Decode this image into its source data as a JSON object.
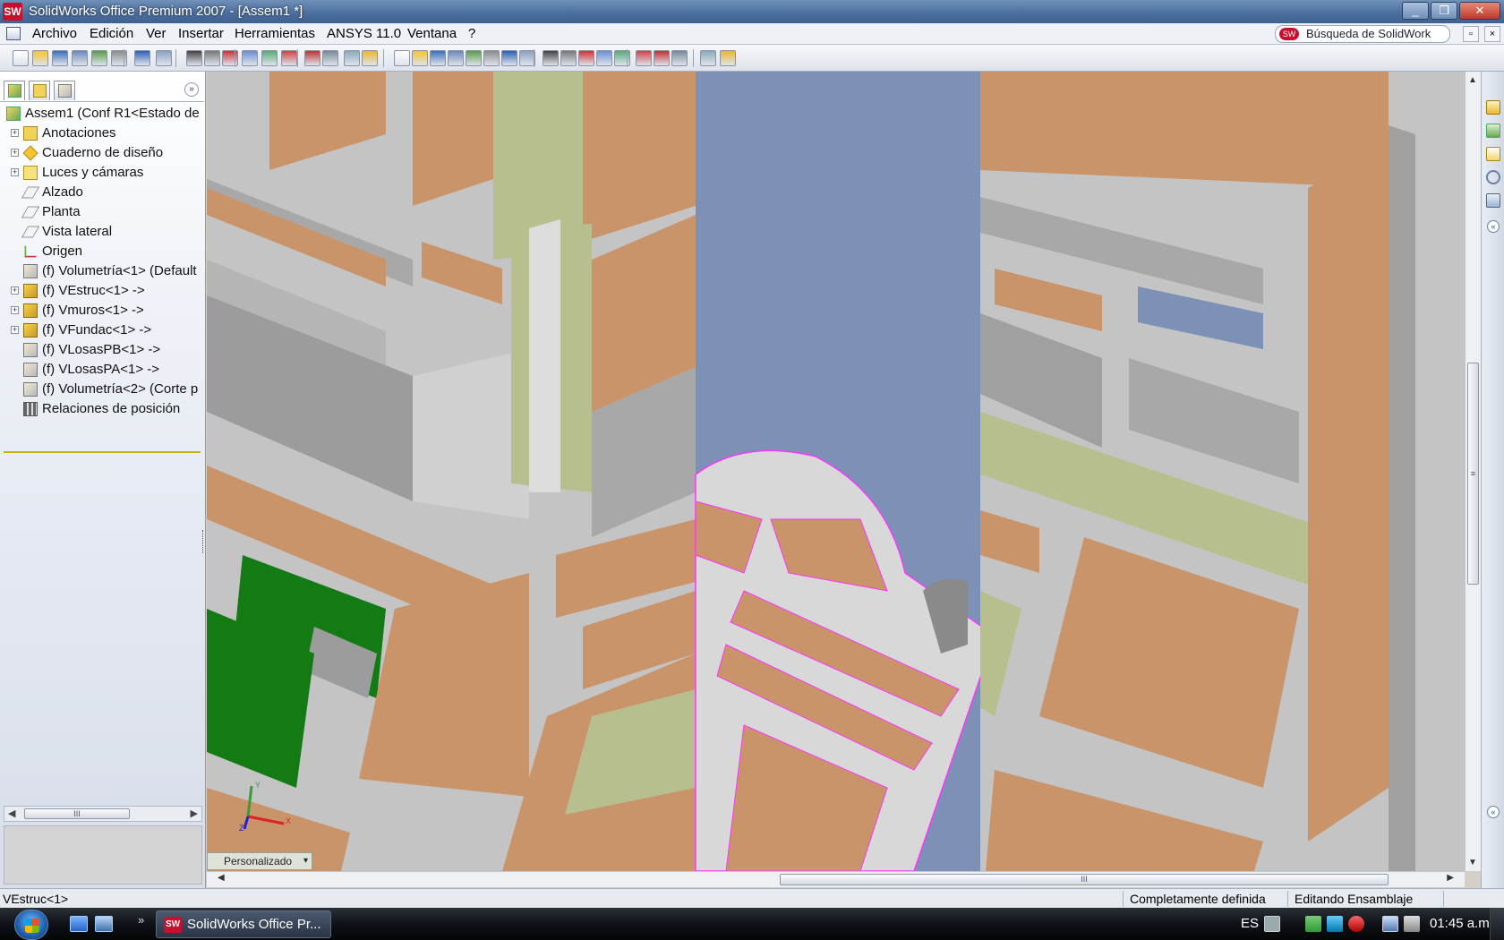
{
  "window": {
    "app_icon": "sw-logo-icon",
    "app_icon_text": "SW",
    "title": "SolidWorks Office Premium 2007 - [Assem1 *]",
    "controls": {
      "minimize": "_",
      "restore": "❐",
      "close": "✕"
    }
  },
  "menu": {
    "items": [
      "Archivo",
      "Edición",
      "Ver",
      "Insertar",
      "Herramientas",
      "ANSYS 11.0",
      "Ventana",
      "?"
    ],
    "search_placeholder": "Búsqueda de SolidWork",
    "search_logo_text": "SW",
    "doc_restore": "▫",
    "doc_close": "×"
  },
  "toolbar": {
    "icons": [
      "new-icon",
      "open-icon",
      "save-icon",
      "print-preview-icon",
      "options-icon",
      "print-icon",
      "undo-icon",
      "redo-icon",
      "select-icon",
      "smart-dimension-icon",
      "rebuild-icon",
      "grid-icon",
      "insert-component-icon",
      "mate-icon",
      "display-style-icon",
      "section-view-icon",
      "properties-icon",
      "help-icon",
      "zoom-fit-icon",
      "zoom-area-icon",
      "zoom-in-out-icon",
      "zoom-selection-icon",
      "rotate-icon",
      "pan-icon",
      "3d-drawing-icon",
      "view-orientation-icon",
      "wireframe-icon",
      "hidden-lines-icon",
      "hidden-removed-icon",
      "shaded-edges-icon",
      "shaded-icon",
      "shadows-icon",
      "realview-icon",
      "appearance-icon",
      "photoworks-icon",
      "animator-icon"
    ]
  },
  "feature_manager": {
    "tabs": [
      "featuremanager-tab-icon",
      "propertymanager-tab-icon",
      "configurationmanager-tab-icon"
    ],
    "expand_glyph": "»",
    "tree": [
      {
        "label": "Assem1  (Conf R1<Estado de",
        "icon": "assembly-icon",
        "expander": "",
        "root": true
      },
      {
        "label": "Anotaciones",
        "icon": "annotations-icon",
        "expander": "+"
      },
      {
        "label": "Cuaderno de diseño",
        "icon": "design-binder-icon",
        "expander": "+"
      },
      {
        "label": "Luces y cámaras",
        "icon": "lights-cameras-icon",
        "expander": "+"
      },
      {
        "label": "Alzado",
        "icon": "plane-icon",
        "expander": ""
      },
      {
        "label": "Planta",
        "icon": "plane-icon",
        "expander": ""
      },
      {
        "label": "Vista lateral",
        "icon": "plane-icon",
        "expander": ""
      },
      {
        "label": "Origen",
        "icon": "origin-icon",
        "expander": ""
      },
      {
        "label": "(f) Volumetría<1> (Default",
        "icon": "part-icon",
        "expander": ""
      },
      {
        "label": "(f) VEstruc<1> ->",
        "icon": "subassembly-icon",
        "expander": "+"
      },
      {
        "label": "(f) Vmuros<1> ->",
        "icon": "subassembly-icon",
        "expander": "+"
      },
      {
        "label": "(f) VFundac<1> ->",
        "icon": "subassembly-icon",
        "expander": "+"
      },
      {
        "label": "(f) VLosasPB<1> ->",
        "icon": "part-icon",
        "expander": ""
      },
      {
        "label": "(f) VLosasPA<1> ->",
        "icon": "part-icon",
        "expander": ""
      },
      {
        "label": "(f) Volumetría<2> (Corte p",
        "icon": "part-icon",
        "expander": ""
      },
      {
        "label": "Relaciones de posición",
        "icon": "mates-icon",
        "expander": ""
      }
    ],
    "hscroll_grip": "III",
    "arrow_left": "◀",
    "arrow_right": "▶"
  },
  "graphics": {
    "view_label": "Personalizado",
    "view_label_dropdown": "▾",
    "triad": {
      "x": "X",
      "y": "Y",
      "z": "Z"
    },
    "vscroll_grip": "≡",
    "hscroll_grip": "III",
    "arrow_up": "▲",
    "arrow_down": "▼",
    "arrow_left": "◀",
    "arrow_right": "▶"
  },
  "taskpane": {
    "icons": [
      "solidworks-resources-icon",
      "design-library-icon",
      "file-explorer-icon",
      "search-icon",
      "view-palette-icon"
    ],
    "collapse_glyph": "«"
  },
  "status": {
    "selection": "VEstruc<1>",
    "definition": "Completamente definida",
    "mode": "Editando Ensamblaje"
  },
  "taskbar": {
    "start": "start-orb-icon",
    "quick_launch": [
      "show-desktop-icon",
      "switch-windows-icon"
    ],
    "more_glyph": "»",
    "active_task": "SolidWorks Office Pr...",
    "active_task_icon_text": "SW",
    "language": "ES",
    "tray_icons": [
      "keyboard-icon",
      "network-icon",
      "update-icon",
      "security-icon",
      "monitor-icon",
      "volume-icon"
    ],
    "clock": "01:45 a.m."
  },
  "colors": {
    "wood": "#c9946a",
    "frame": "#c4c4c4",
    "panel_green": "#b8bf8e",
    "selected_green": "#147a14",
    "highlight_magenta": "#ff33ff"
  }
}
